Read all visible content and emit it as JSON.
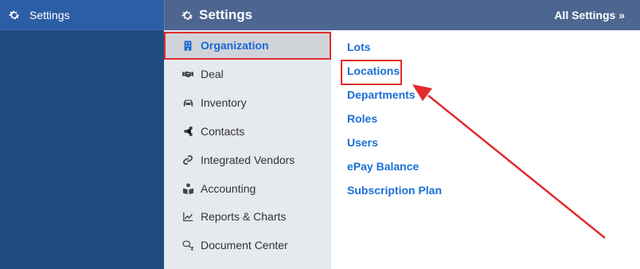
{
  "left_sidebar": {
    "title": "Settings",
    "icon": "gear-icon"
  },
  "header": {
    "title": "Settings",
    "icon": "gear-icon",
    "all_settings_link": "All Settings »"
  },
  "categories": [
    {
      "label": "Organization",
      "icon": "building-icon",
      "active": true
    },
    {
      "label": "Deal",
      "icon": "handshake-icon",
      "active": false
    },
    {
      "label": "Inventory",
      "icon": "car-icon",
      "active": false
    },
    {
      "label": "Contacts",
      "icon": "share-icon",
      "active": false
    },
    {
      "label": "Integrated Vendors",
      "icon": "link-icon",
      "active": false
    },
    {
      "label": "Accounting",
      "icon": "book-reader-icon",
      "active": false
    },
    {
      "label": "Reports & Charts",
      "icon": "chart-line-icon",
      "active": false
    },
    {
      "label": "Document Center",
      "icon": "comments-icon",
      "active": false
    }
  ],
  "sub_links": [
    {
      "label": "Lots"
    },
    {
      "label": "Locations",
      "highlighted": true
    },
    {
      "label": "Departments"
    },
    {
      "label": "Roles"
    },
    {
      "label": "Users"
    },
    {
      "label": "ePay Balance"
    },
    {
      "label": "Subscription Plan"
    }
  ],
  "colors": {
    "sidebar_dark": "#1f4a80",
    "sidebar_head": "#2c5ea6",
    "header_bg": "#4d6690",
    "menu_bg": "#e6e9ed",
    "active_bg": "#d0d4d9",
    "link_blue": "#1a6fd6",
    "annotation_red": "#e32b2b"
  }
}
